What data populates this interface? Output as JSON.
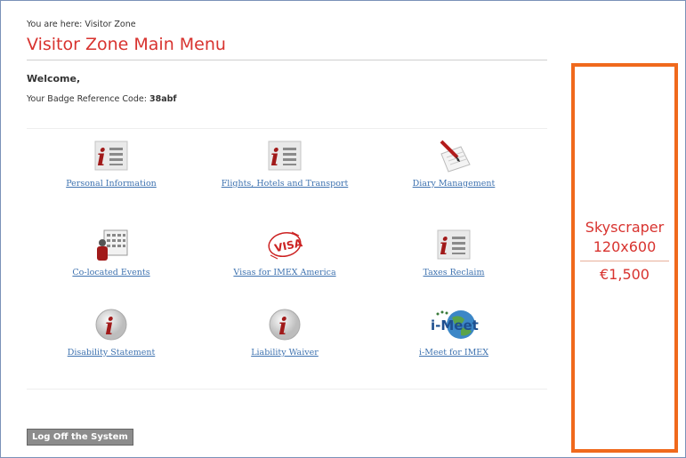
{
  "breadcrumb": {
    "prefix": "You are here:",
    "current": "Visitor Zone"
  },
  "page_title": "Visitor Zone Main Menu",
  "welcome": "Welcome,",
  "badge": {
    "label": "Your Badge Reference Code:",
    "code": "38abf"
  },
  "menu": [
    {
      "label": "Personal Information",
      "icon": "info-document-icon"
    },
    {
      "label": "Flights, Hotels and Transport",
      "icon": "info-document-icon"
    },
    {
      "label": "Diary Management",
      "icon": "notepad-pen-icon"
    },
    {
      "label": "Co-located Events",
      "icon": "calendar-event-icon"
    },
    {
      "label": "Visas for IMEX America",
      "icon": "visa-stamp-icon"
    },
    {
      "label": "Taxes Reclaim",
      "icon": "info-document-icon"
    },
    {
      "label": "Disability Statement",
      "icon": "info-circle-icon"
    },
    {
      "label": "Liability Waiver",
      "icon": "info-circle-icon"
    },
    {
      "label": "i-Meet for IMEX",
      "icon": "imeet-globe-icon"
    }
  ],
  "imeet_logo_text": "i-Meet",
  "logoff_label": "Log Off the System",
  "ad": {
    "line1": "Skyscraper",
    "line2": "120x600",
    "price": "€1,500"
  },
  "colors": {
    "title": "#d8332f",
    "link": "#3f73b0",
    "ad_border": "#f0691c",
    "logoff_bg": "#8c8c8c"
  }
}
